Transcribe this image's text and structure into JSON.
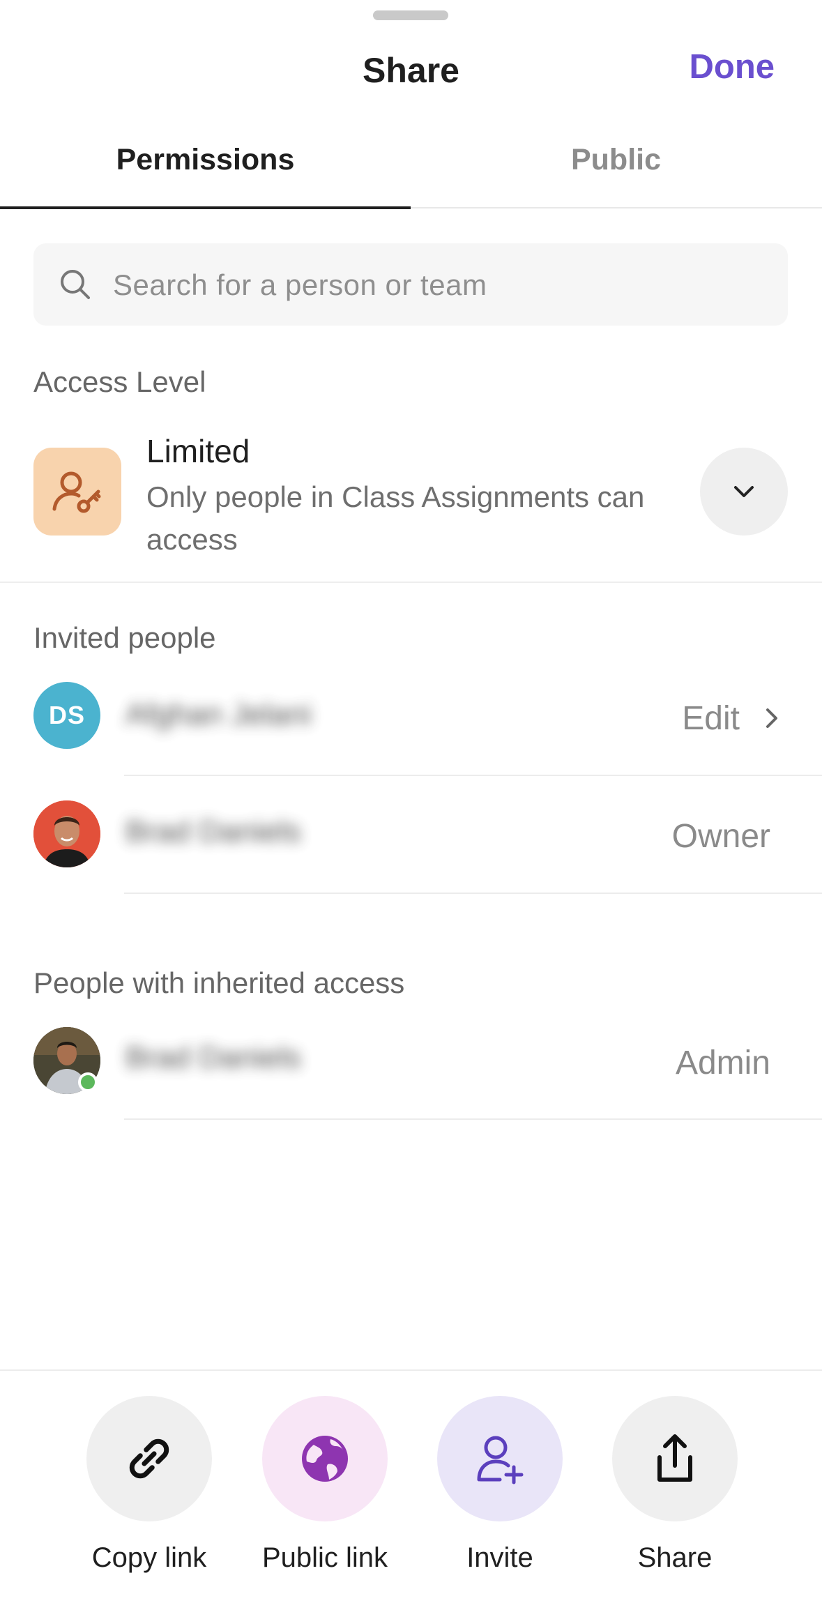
{
  "header": {
    "title": "Share",
    "done_label": "Done"
  },
  "tabs": [
    {
      "label": "Permissions",
      "selected": true
    },
    {
      "label": "Public",
      "selected": false
    }
  ],
  "search": {
    "placeholder": "Search for a person or team",
    "value": ""
  },
  "access_level": {
    "section_label": "Access Level",
    "title": "Limited",
    "description": "Only people in Class Assignments can access",
    "icon": "person-key-icon",
    "icon_bg": "#f8d3ad"
  },
  "invited_people": {
    "section_label": "Invited people",
    "people": [
      {
        "initials": "DS",
        "name": "Afghan Jelani",
        "role": "Edit",
        "avatar_color": "#4bb3cf"
      },
      {
        "name": "Brad Daniels",
        "role": "Owner"
      }
    ]
  },
  "inherited_access": {
    "section_label": "People with inherited access",
    "people": [
      {
        "name": "Brad Daniels",
        "role": "Admin",
        "online": true
      }
    ]
  },
  "actions": [
    {
      "label": "Copy link",
      "icon": "link-icon",
      "bg": "#efefef"
    },
    {
      "label": "Public link",
      "icon": "globe-icon",
      "bg": "#f8e6f6"
    },
    {
      "label": "Invite",
      "icon": "add-person-icon",
      "bg": "#e9e5f8"
    },
    {
      "label": "Share",
      "icon": "share-icon",
      "bg": "#efefef"
    }
  ],
  "colors": {
    "accent": "#6a4fcf",
    "globe": "#8e35b0",
    "invite": "#6a4fcf",
    "online": "#5cb85c"
  }
}
